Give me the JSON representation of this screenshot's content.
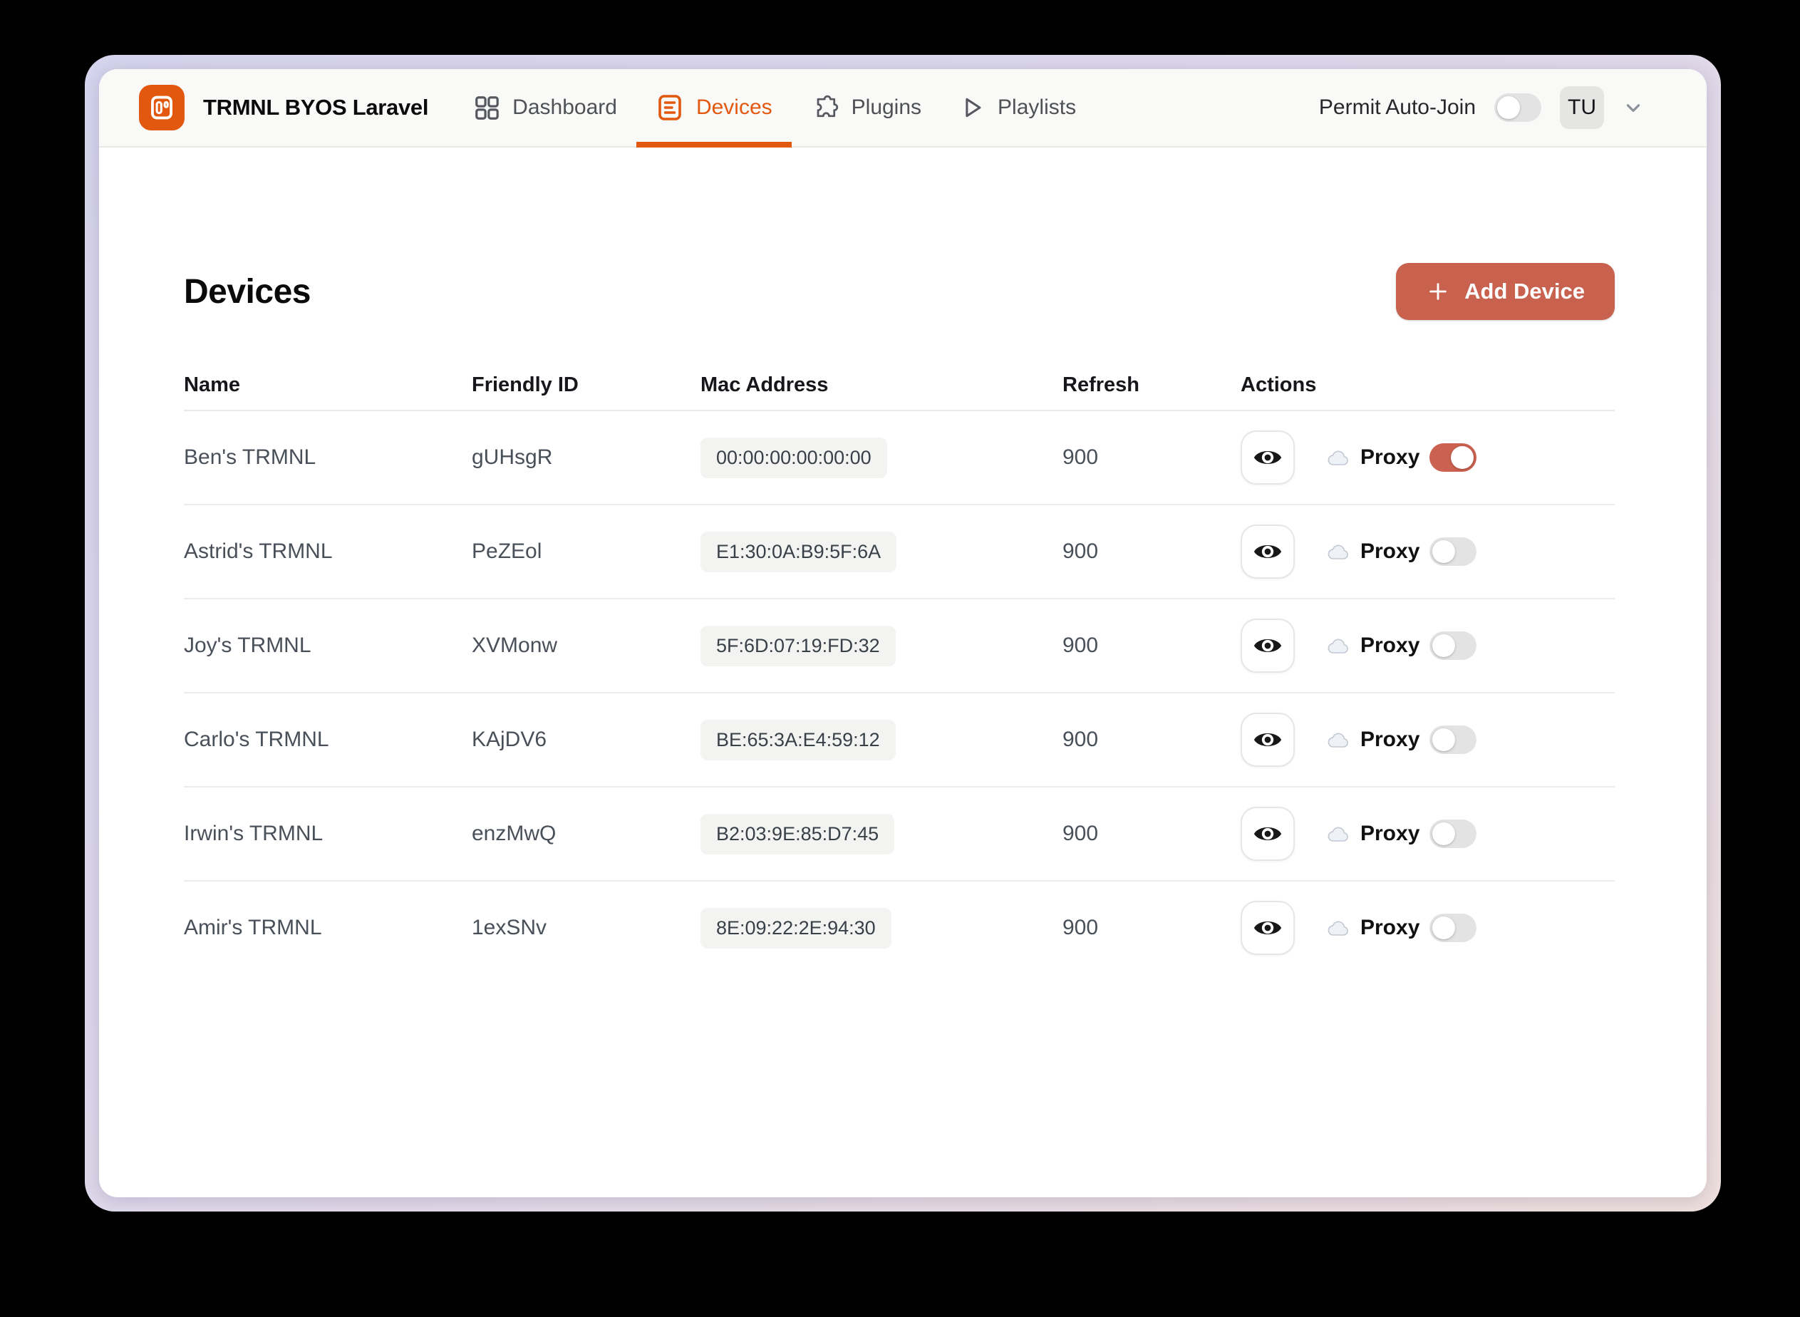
{
  "colors": {
    "brand_orange": "#e2580e",
    "accent_salmon": "#c9614f",
    "toggle_on": "#cb6151",
    "header_bg": "#f9f9f8",
    "frame_gradient_start": "#d7d5ee",
    "frame_gradient_end": "#efe0de"
  },
  "header": {
    "brand": {
      "title": "TRMNL BYOS Laravel",
      "logo_icon": "trmnl-device-icon"
    },
    "nav": [
      {
        "label": "Dashboard",
        "icon": "grid-icon",
        "active": false
      },
      {
        "label": "Devices",
        "icon": "list-box-icon",
        "active": true
      },
      {
        "label": "Plugins",
        "icon": "puzzle-icon",
        "active": false
      },
      {
        "label": "Playlists",
        "icon": "play-icon",
        "active": false
      }
    ],
    "permit_auto_join": {
      "label": "Permit Auto-Join",
      "enabled": false
    },
    "avatar": {
      "initials": "TU"
    }
  },
  "page": {
    "title": "Devices",
    "add_button": {
      "label": "Add Device",
      "icon": "plus-icon"
    },
    "table": {
      "columns": [
        "Name",
        "Friendly ID",
        "Mac Address",
        "Refresh",
        "Actions"
      ],
      "proxy_label": "Proxy",
      "rows": [
        {
          "name": "Ben's TRMNL",
          "friendly_id": "gUHsgR",
          "mac": "00:00:00:00:00:00",
          "refresh": "900",
          "proxy_enabled": true
        },
        {
          "name": "Astrid's TRMNL",
          "friendly_id": "PeZEol",
          "mac": "E1:30:0A:B9:5F:6A",
          "refresh": "900",
          "proxy_enabled": false
        },
        {
          "name": "Joy's TRMNL",
          "friendly_id": "XVMonw",
          "mac": "5F:6D:07:19:FD:32",
          "refresh": "900",
          "proxy_enabled": false
        },
        {
          "name": "Carlo's TRMNL",
          "friendly_id": "KAjDV6",
          "mac": "BE:65:3A:E4:59:12",
          "refresh": "900",
          "proxy_enabled": false
        },
        {
          "name": "Irwin's TRMNL",
          "friendly_id": "enzMwQ",
          "mac": "B2:03:9E:85:D7:45",
          "refresh": "900",
          "proxy_enabled": false
        },
        {
          "name": "Amir's TRMNL",
          "friendly_id": "1exSNv",
          "mac": "8E:09:22:2E:94:30",
          "refresh": "900",
          "proxy_enabled": false
        }
      ]
    }
  }
}
